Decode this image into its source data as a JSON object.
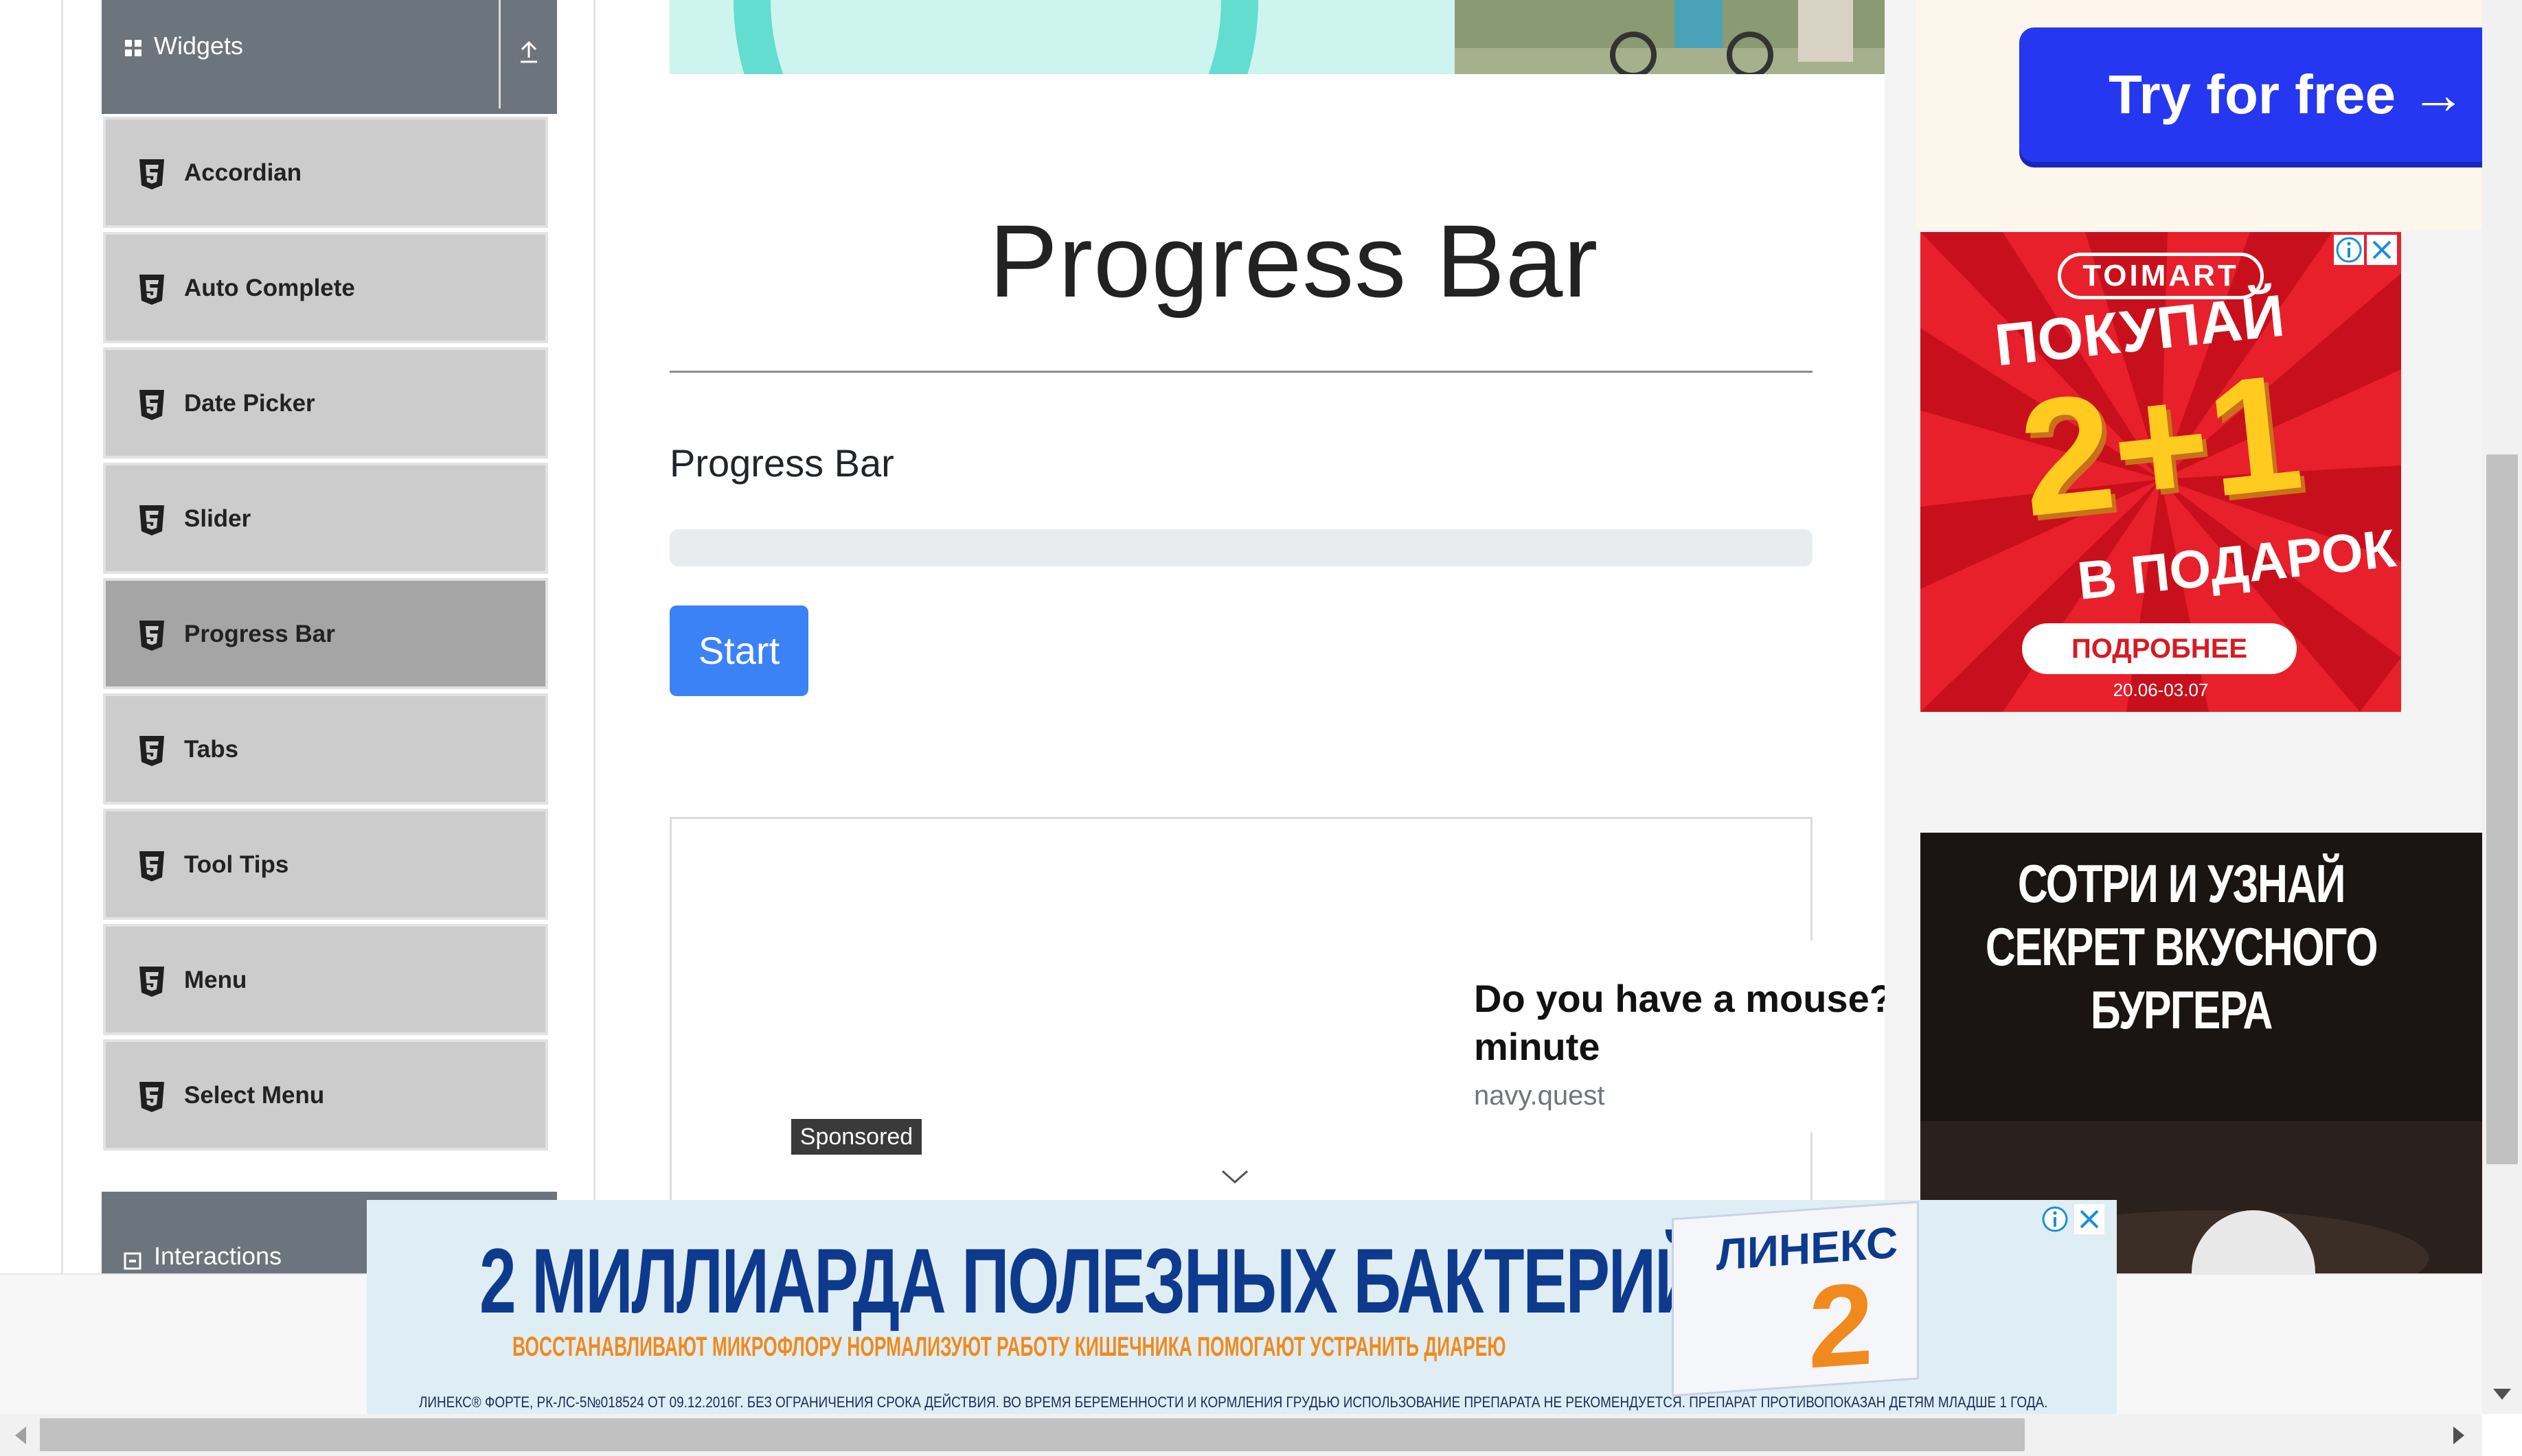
{
  "sidebar": {
    "widgets_header": {
      "label": "Widgets",
      "icon": "grid-icon",
      "collapse_icon": "collapse-up-icon"
    },
    "items": [
      {
        "label": "Accordian",
        "icon": "html5-icon",
        "active": false
      },
      {
        "label": "Auto Complete",
        "icon": "html5-icon",
        "active": false
      },
      {
        "label": "Date Picker",
        "icon": "html5-icon",
        "active": false
      },
      {
        "label": "Slider",
        "icon": "html5-icon",
        "active": false
      },
      {
        "label": "Progress Bar",
        "icon": "html5-icon",
        "active": true
      },
      {
        "label": "Tabs",
        "icon": "html5-icon",
        "active": false
      },
      {
        "label": "Tool Tips",
        "icon": "html5-icon",
        "active": false
      },
      {
        "label": "Menu",
        "icon": "html5-icon",
        "active": false
      },
      {
        "label": "Select Menu",
        "icon": "html5-icon",
        "active": false
      }
    ],
    "interactions_header": {
      "label": "Interactions",
      "icon": "interactions-icon"
    }
  },
  "main": {
    "title": "Progress Bar",
    "section_label": "Progress Bar",
    "progress": {
      "value_percent": 0,
      "fill_color": "#17a2b8",
      "track_color": "#e9ecef"
    },
    "start_button": {
      "label": "Start",
      "color": "#3b82f6"
    }
  },
  "ads": {
    "sponsored_label": "Sponsored",
    "native": {
      "title": "Do you have a mouse? minute",
      "domain": "navy.quest"
    },
    "try_free": {
      "label": "Try for free →"
    },
    "toimart": {
      "logo": "TOIMART",
      "headline": "ПОКУПАЙ",
      "offer": "2+1",
      "gift": "В ПОДАРОК",
      "button": "ПОДРОБНЕЕ",
      "dates": "20.06-03.07"
    },
    "burger": {
      "text": "СОТРИ И УЗНАЙ СЕКРЕТ ВКУСНОГО БУРГЕРА"
    },
    "bottom": {
      "headline": "2 МИЛЛИАРДА ПОЛЕЗНЫХ БАКТЕРИЙ",
      "subline": "ВОССТАНАВЛИВАЮТ МИКРОФЛОРУ  НОРМАЛИЗУЮТ РАБОТУ КИШЕЧНИКА  ПОМОГАЮТ УСТРАНИТЬ ДИАРЕЮ",
      "legal": "ЛИНЕКС® ФОРТЕ, РК-ЛС-5№018524 ОТ 09.12.2016Г. БЕЗ ОГРАНИЧЕНИЯ СРОКА ДЕЙСТВИЯ. ВО ВРЕМЯ БЕРЕМЕННОСТИ И КОРМЛЕНИЯ ГРУДЬЮ ИСПОЛЬЗОВАНИЕ ПРЕПАРАТА НЕ РЕКОМЕНДУЕТСЯ. ПРЕПАРАТ ПРОТИВОПОКАЗАН ДЕТЯМ МЛАДШЕ 1 ГОДА.",
      "brand": "ЛИНЕКС",
      "pack_number": "2"
    }
  },
  "colors": {
    "sidebar_header": "#6c757d",
    "sidebar_item": "#cccccc",
    "sidebar_item_active": "#a5a5a5",
    "toimart_red": "#e8202c",
    "try_free_blue": "#2537f0"
  }
}
